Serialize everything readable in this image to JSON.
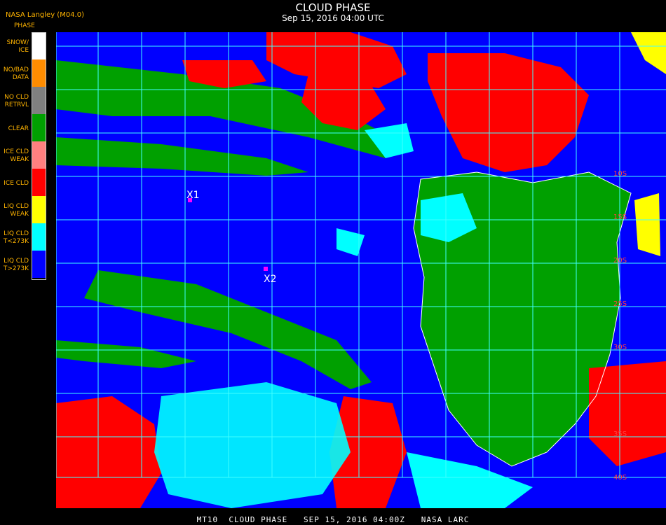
{
  "header": {
    "agency": "NASA Langley (M04.0)",
    "title": "CLOUD PHASE",
    "subtitle": "Sep 15, 2016 04:00 UTC",
    "legend_title": "PHASE"
  },
  "legend": [
    {
      "label": "SNOW/\nICE",
      "color": "#ffffff"
    },
    {
      "label": "NO/BAD\nDATA",
      "color": "#ff8c00"
    },
    {
      "label": "NO CLD\nRETRVL",
      "color": "#808080"
    },
    {
      "label": "CLEAR",
      "color": "#00a000"
    },
    {
      "label": "ICE CLD\nWEAK",
      "color": "#ff8080"
    },
    {
      "label": "ICE CLD",
      "color": "#ff0000"
    },
    {
      "label": "LIQ CLD\nWEAK",
      "color": "#ffff00"
    },
    {
      "label": "LIQ CLD\nT<273K",
      "color": "#00ffff"
    },
    {
      "label": "LIQ CLD\nT>273K",
      "color": "#0000ff"
    }
  ],
  "map": {
    "markers": [
      {
        "label": "X1",
        "color": "#ff00ff"
      },
      {
        "label": "X2",
        "color": "#ff00ff"
      }
    ],
    "lat_labels": [
      "10S",
      "15S",
      "20S",
      "25S",
      "30S",
      "35S",
      "40S"
    ],
    "lat_label_color": "#ff4040",
    "grid_color": "#40ffff"
  },
  "footer": {
    "text": "MT10  CLOUD PHASE   SEP 15, 2016 04:00Z   NASA LARC"
  }
}
